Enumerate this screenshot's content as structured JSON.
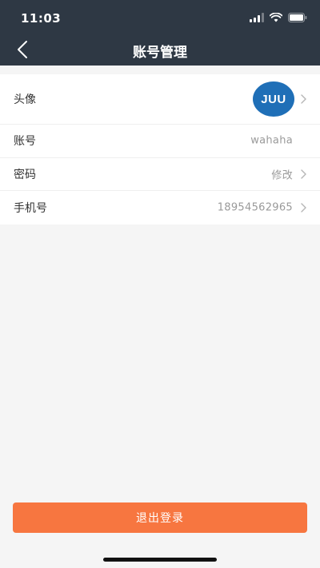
{
  "status_bar": {
    "time": "11:03"
  },
  "nav": {
    "title": "账号管理",
    "back_icon": "chevron-left-icon"
  },
  "rows": [
    {
      "label": "头像",
      "avatar_text": "JUU",
      "avatar_color": "#1f6fb7"
    },
    {
      "label": "账号",
      "value": "wahaha"
    },
    {
      "label": "密码",
      "value": "修改"
    },
    {
      "label": "手机号",
      "value": "18954562965"
    }
  ],
  "logout": {
    "label": "退出登录",
    "color": "#f77640"
  },
  "colors": {
    "header_bg": "#2e3844",
    "page_bg": "#f5f5f5"
  }
}
